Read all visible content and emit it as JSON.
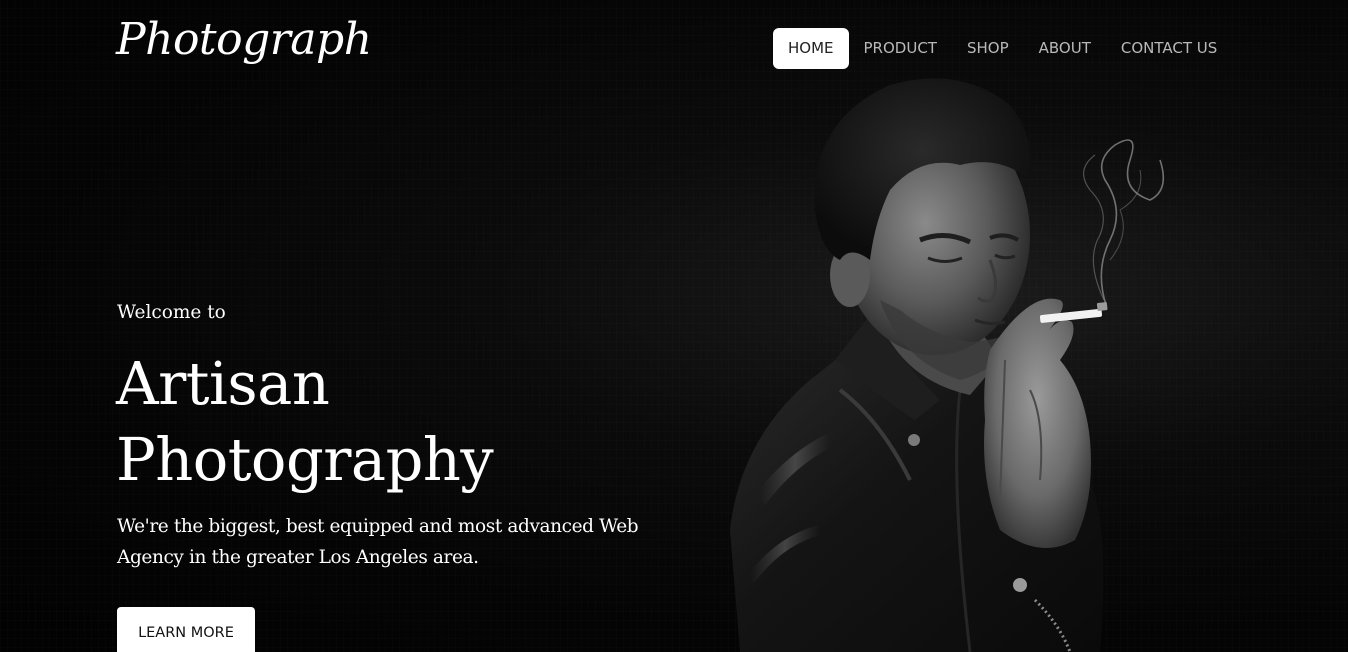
{
  "header": {
    "logo": "Photograph",
    "nav": [
      {
        "label": "HOME",
        "active": true
      },
      {
        "label": "PRODUCT",
        "active": false
      },
      {
        "label": "SHOP",
        "active": false
      },
      {
        "label": "ABOUT",
        "active": false
      },
      {
        "label": "CONTACT US",
        "active": false
      }
    ]
  },
  "hero": {
    "welcome": "Welcome to",
    "title_line1": "Artisan",
    "title_line2": "Photography",
    "tagline_line1": "We're the biggest, best equipped and most advanced Web",
    "tagline_line2": "Agency in the greater Los Angeles area.",
    "cta_label": "LEARN MORE"
  },
  "colors": {
    "background": "#050505",
    "text": "#ffffff",
    "nav_inactive": "#b9b9b9",
    "nav_active_bg": "#ffffff",
    "nav_active_text": "#222222"
  }
}
